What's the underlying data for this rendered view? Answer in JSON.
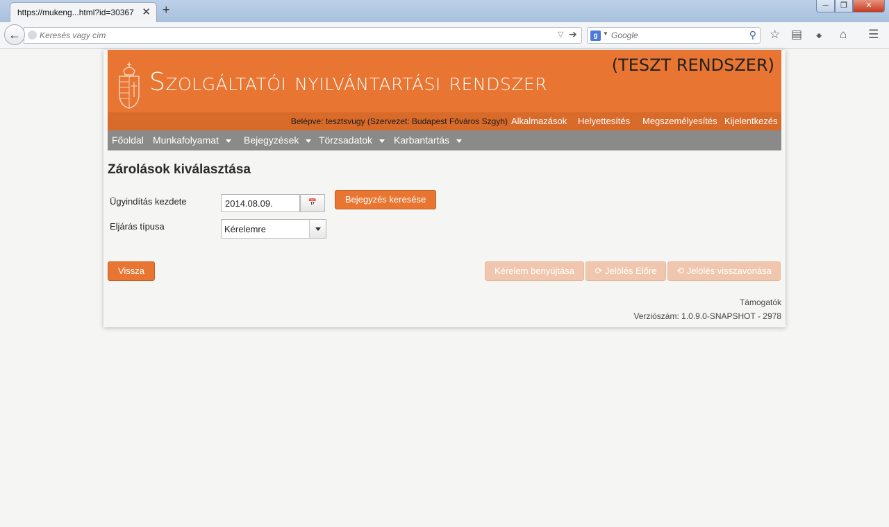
{
  "browser": {
    "tab_title": "https://mukeng...html?id=30367",
    "tab_close": "✕",
    "new_tab": "+",
    "url_placeholder": "Keresés vagy cím",
    "search_placeholder": "Google",
    "search_engine_badge": "g"
  },
  "header": {
    "site_title": "Szolgáltatói nyilvántartási rendszer",
    "test_badge": "(TESZT RENDSZER)"
  },
  "userbar": {
    "login_info": "Belépve: tesztsvugy (Szervezet: Budapest Főváros Szgyh)",
    "links": [
      "Alkalmazások",
      "Helyettesítés",
      "Megszemélyesítés",
      "Kijelentkezés"
    ]
  },
  "menu": {
    "items": [
      "Főoldal",
      "Munkafolyamat",
      "Bejegyzések",
      "Törzsadatok",
      "Karbantartás"
    ]
  },
  "main": {
    "title": "Zárolások kiválasztása",
    "start_label": "Ügyindítás kezdete",
    "start_value": "2014.08.09.",
    "search_button": "Bejegyzés keresése",
    "type_label": "Eljárás típusa",
    "type_value": "Kérelemre"
  },
  "actions": {
    "back": "Vissza",
    "submit": "Kérelem benyújtása",
    "mark_forward": "Jelölés Előre",
    "mark_revoke": "Jelölés visszavonása"
  },
  "footer": {
    "supporters": "Támogatók",
    "version": "Verziószám: 1.0.9.0-SNAPSHOT - 2978"
  },
  "colors": {
    "brand_orange": "#e87632",
    "menu_gray": "#8a8a88"
  }
}
